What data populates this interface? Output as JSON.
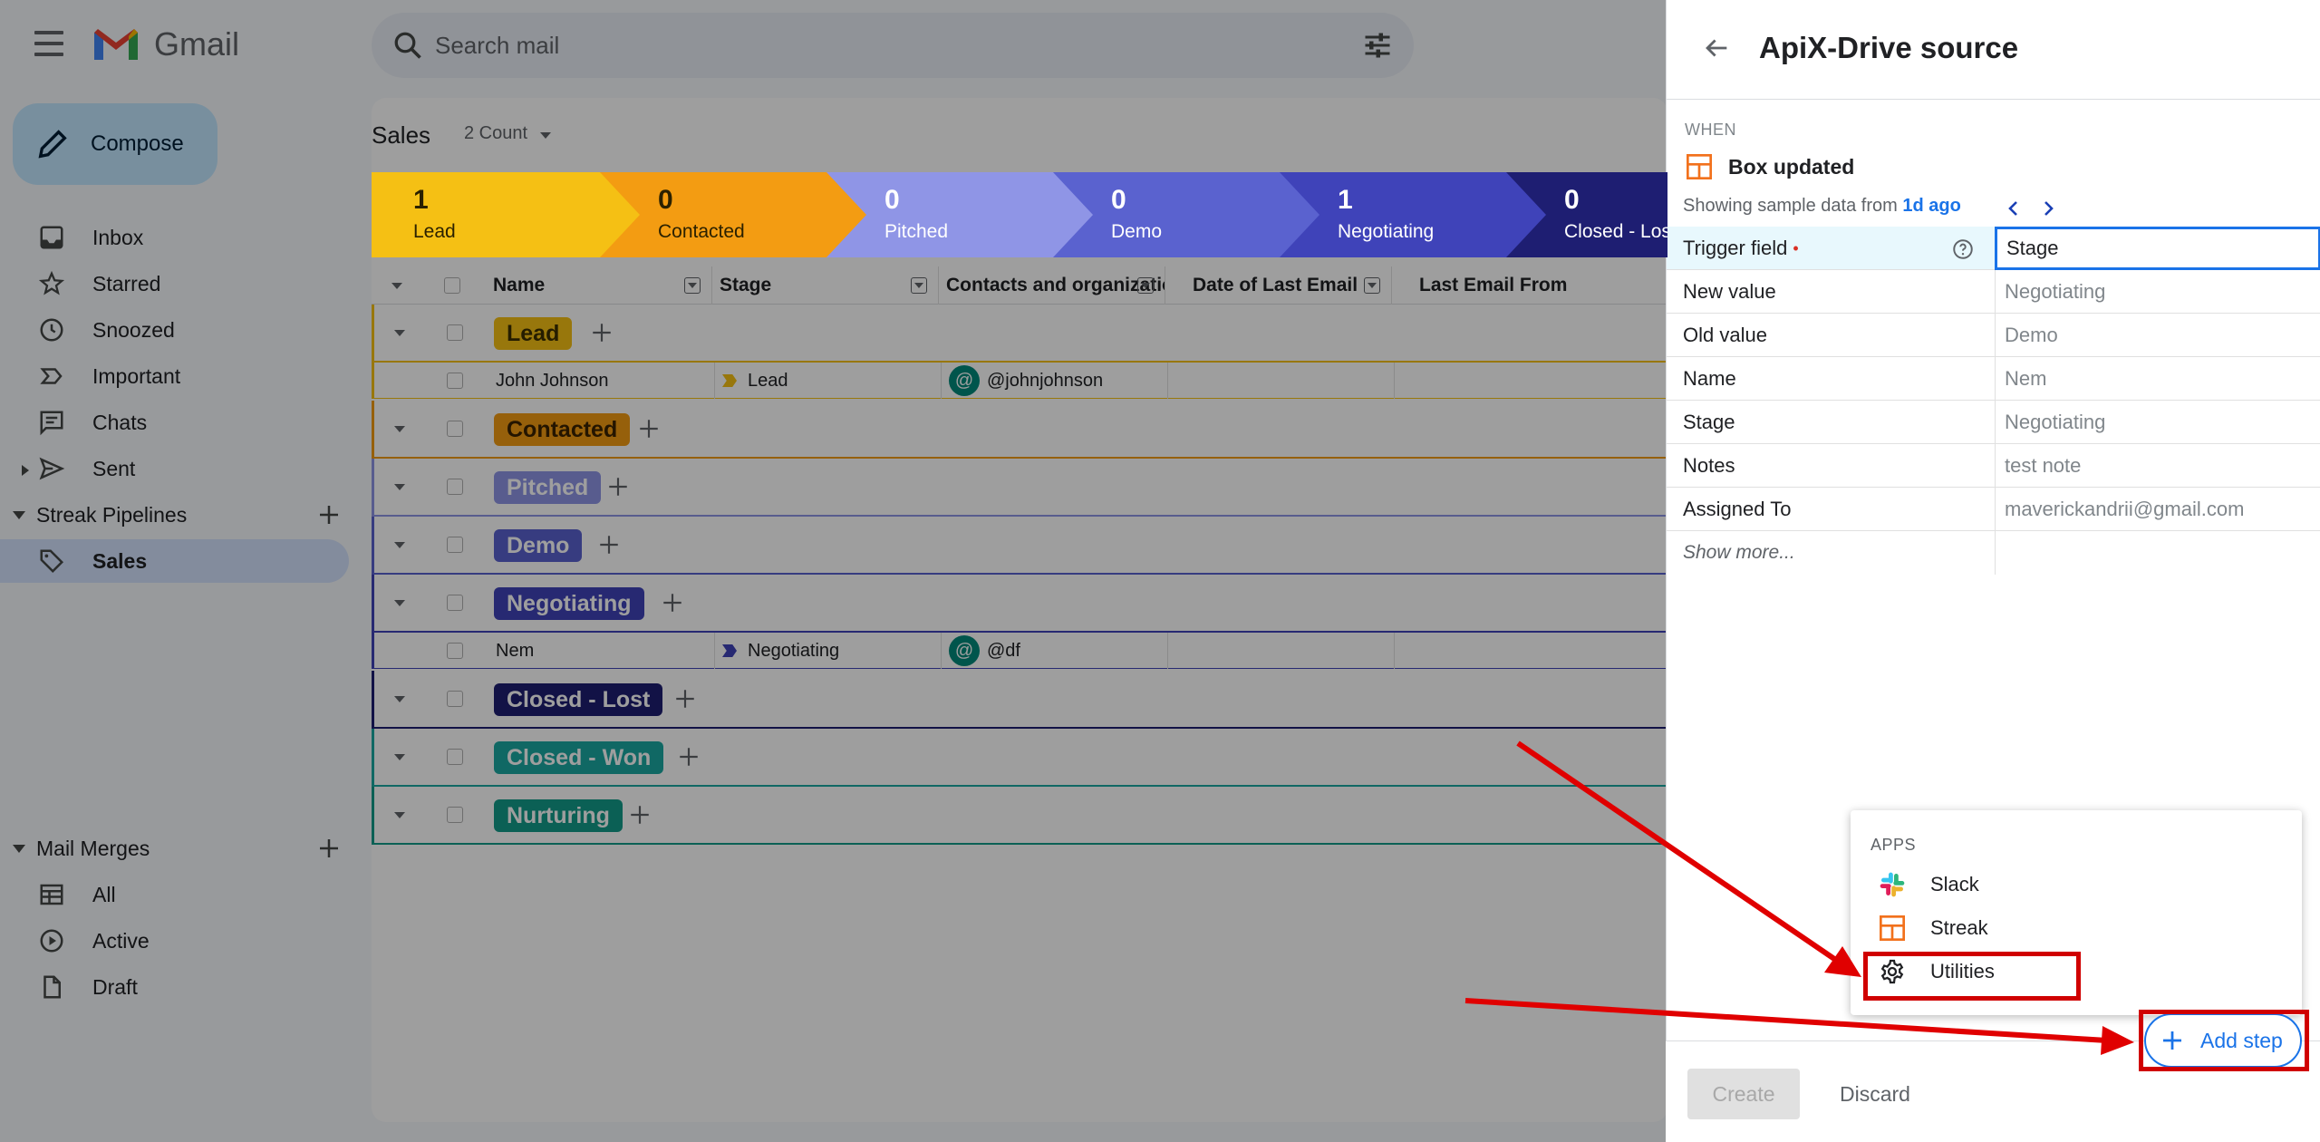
{
  "gmail": {
    "logo_text": "Gmail",
    "search_placeholder": "Search mail",
    "compose_label": "Compose",
    "nav": [
      "Inbox",
      "Starred",
      "Snoozed",
      "Important",
      "Chats",
      "Sent"
    ],
    "streak_section": "Streak Pipelines",
    "streak_items": [
      "Sales"
    ],
    "mail_merges_section": "Mail Merges",
    "mail_merges_items": [
      "All",
      "Active",
      "Draft"
    ]
  },
  "pipeline": {
    "title": "Sales",
    "count_label": "2 Count",
    "stages": [
      {
        "count": "1",
        "name": "Lead",
        "color": "#f5c014"
      },
      {
        "count": "0",
        "name": "Contacted",
        "color": "#f39c12"
      },
      {
        "count": "0",
        "name": "Pitched",
        "color": "#8f95e6"
      },
      {
        "count": "0",
        "name": "Demo",
        "color": "#5a62cf"
      },
      {
        "count": "1",
        "name": "Negotiating",
        "color": "#3f43b9"
      },
      {
        "count": "0",
        "name": "Closed - Lost",
        "color": "#1e1e72"
      }
    ],
    "columns": [
      "Name",
      "Stage",
      "Contacts and organizations",
      "Date of Last Email",
      "Last Email From"
    ],
    "groups": [
      {
        "name": "Lead",
        "color": "#f5c014",
        "text": "#3c3000"
      },
      {
        "name": "Contacted",
        "color": "#f39c12",
        "text": "#3a2200"
      },
      {
        "name": "Pitched",
        "color": "#8f95e6",
        "text": "#ffffff"
      },
      {
        "name": "Demo",
        "color": "#5a62cf",
        "text": "#ffffff"
      },
      {
        "name": "Negotiating",
        "color": "#3f43b9",
        "text": "#ffffff"
      },
      {
        "name": "Closed - Lost",
        "color": "#1e1e72",
        "text": "#ffffff"
      },
      {
        "name": "Closed - Won",
        "color": "#1aa9a2",
        "text": "#ffffff"
      },
      {
        "name": "Nurturing",
        "color": "#129b8a",
        "text": "#ffffff"
      }
    ],
    "rows": [
      {
        "name": "John Johnson",
        "stage": "Lead",
        "contact": "@johnjohnson"
      },
      {
        "name": "Nem",
        "stage": "Negotiating",
        "contact": "@df"
      }
    ]
  },
  "panel": {
    "title": "ApiX-Drive source",
    "when_label": "WHEN",
    "trigger_label": "Box updated",
    "sample_prefix": "Showing sample data from",
    "sample_link": "1d ago",
    "fields": [
      {
        "key": "Trigger field",
        "value": "Stage"
      },
      {
        "key": "New value",
        "value": "Negotiating"
      },
      {
        "key": "Old value",
        "value": "Demo"
      },
      {
        "key": "Name",
        "value": "Nem"
      },
      {
        "key": "Stage",
        "value": "Negotiating"
      },
      {
        "key": "Notes",
        "value": "test note"
      },
      {
        "key": "Assigned To",
        "value": "maverickandrii@gmail.com"
      }
    ],
    "required_mark": "•",
    "show_more": "Show more...",
    "menu": {
      "header": "APPS",
      "items": [
        "Slack",
        "Streak",
        "Utilities"
      ]
    },
    "add_step_label": "Add step",
    "create_label": "Create",
    "discard_label": "Discard"
  }
}
